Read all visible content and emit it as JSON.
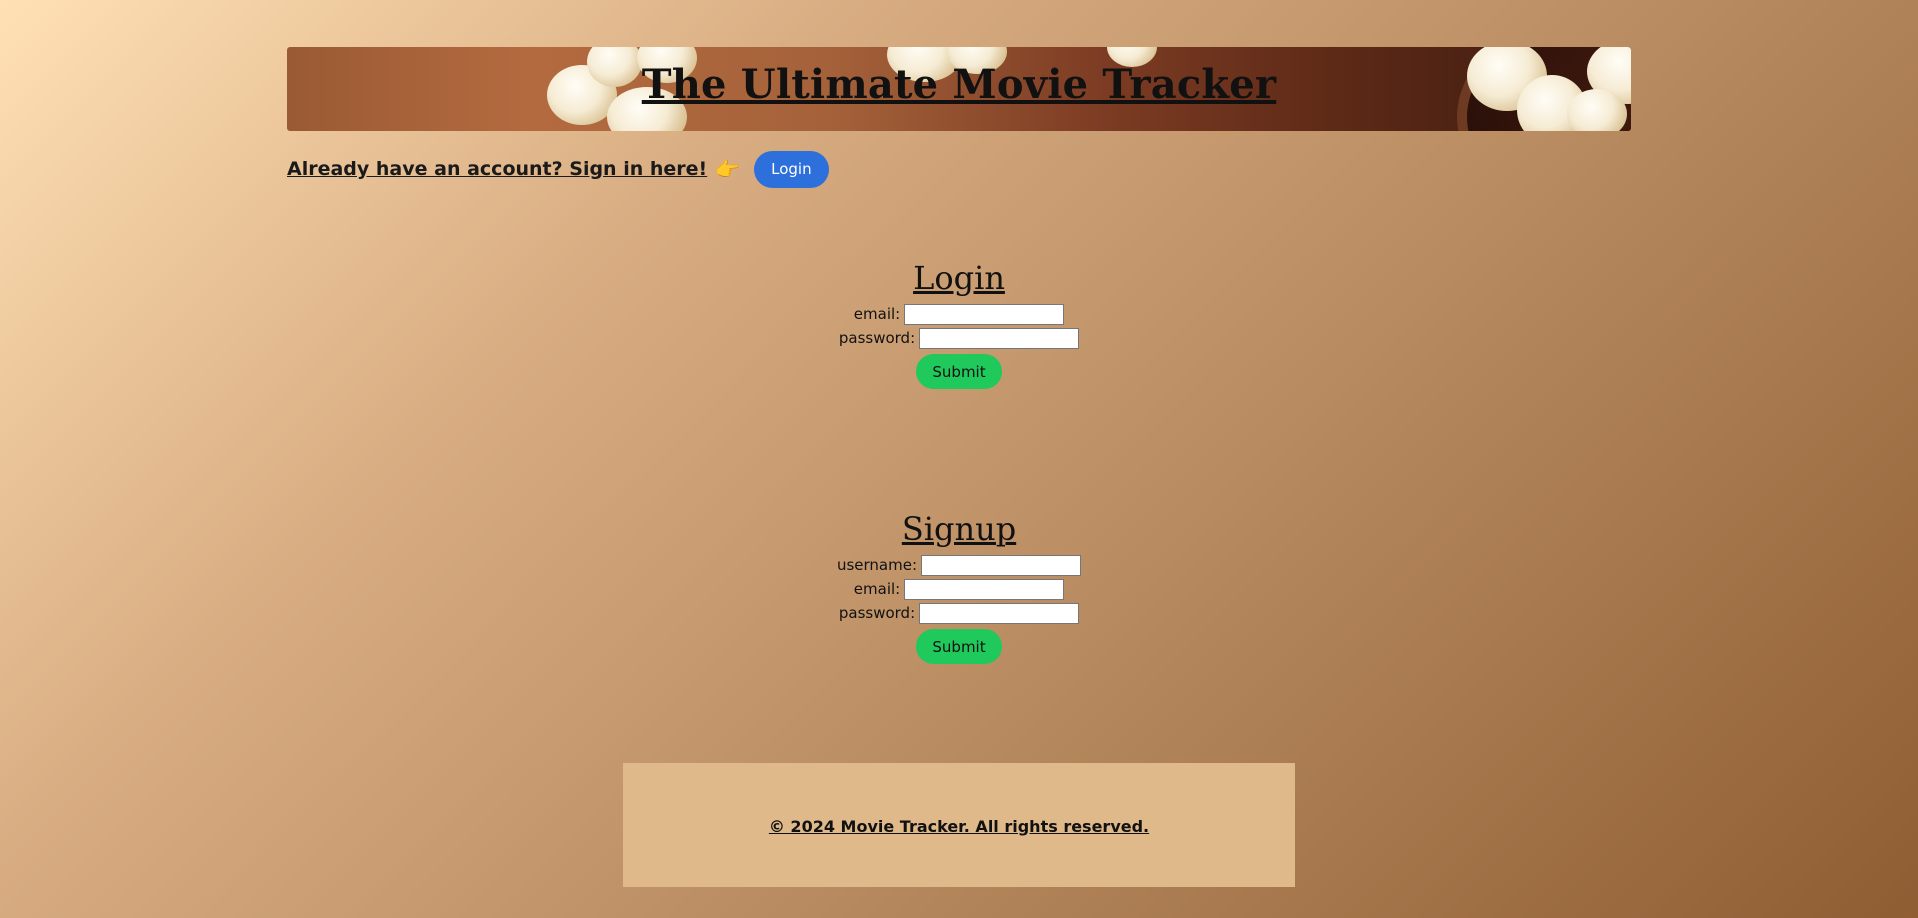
{
  "header": {
    "title": "The Ultimate Movie Tracker",
    "banner_image": "popcorn-photo"
  },
  "account_prompt": {
    "text": "Already have an account? Sign in here!",
    "hand_icon": "👉",
    "login_button": "Login"
  },
  "login_form": {
    "heading": "Login",
    "fields": [
      {
        "label": "email:",
        "value": "",
        "placeholder": ""
      },
      {
        "label": "password:",
        "value": "",
        "placeholder": ""
      }
    ],
    "submit_label": "Submit"
  },
  "signup_form": {
    "heading": "Signup",
    "fields": [
      {
        "label": "username:",
        "value": "",
        "placeholder": ""
      },
      {
        "label": "email:",
        "value": "",
        "placeholder": ""
      },
      {
        "label": "password:",
        "value": "",
        "placeholder": ""
      }
    ],
    "submit_label": "Submit"
  },
  "footer": {
    "text": "© 2024 Movie Tracker. All rights reserved."
  },
  "colors": {
    "login_button": "#2d6fdb",
    "submit_button": "#1fc95b",
    "footer_background": "#e0b98a"
  }
}
